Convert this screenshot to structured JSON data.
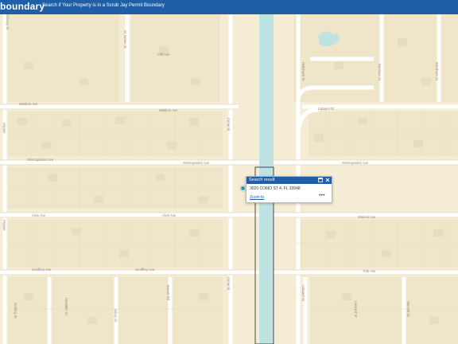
{
  "header": {
    "title": "boundary",
    "subtitle": "Search if Your Property is in a Scrub Jay Permit Boundary"
  },
  "map": {
    "streets": {
      "cliff": "Cliff Ave",
      "waldrun1": "Waldrun Ave",
      "waldrun2": "Waldrun Ave",
      "wintergarden1": "Wintergarden Ave",
      "wintergarden2": "Wintergarden Ave",
      "wintergarden3": "Wintergarden Ave",
      "alvin1": "Alvin Ave",
      "alvin2": "Alvin Ave",
      "watson": "Watson Ave",
      "geoffrey1": "Geoffrey Ave",
      "geoffrey2": "Geoffrey Ave",
      "york": "York Ave",
      "cabaret": "Cabaret St",
      "como1": "Como St",
      "como2": "Como St",
      "cabaret2": "Cabaret St",
      "s1": "St James St",
      "s2": "Hopper",
      "s3": "Hopper",
      "s4": "Barrett Rd",
      "s5": "Gilroy St",
      "s6": "Gulding St",
      "s7": "Hamilton St",
      "s8": "Lanyard St",
      "s9": "Sennett St",
      "s10": "Hollyhock St",
      "s11": "Windham St",
      "s12": "Harrison St",
      "s13": "Chicory St"
    }
  },
  "popup": {
    "title": "Search result",
    "address": "3020 COMO ST 4, FL 33948",
    "zoom_label": "Zoom to",
    "more_label": "•••",
    "dock_icon": "dock-icon",
    "close_icon": "close-icon"
  },
  "colors": {
    "header": "#1f5fa8",
    "canal": "#bfe3e3",
    "map_bg": "#f4ecd4",
    "road": "#ffffff",
    "building": "#e6dcc0"
  }
}
